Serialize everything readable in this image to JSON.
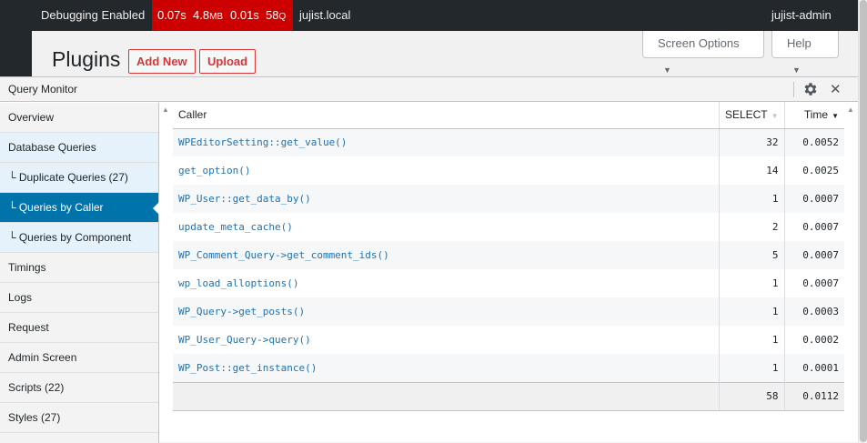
{
  "admin_bar": {
    "debugging": "Debugging Enabled",
    "qm_time": "0.07s",
    "qm_memory": "4.8",
    "qm_memory_unit": "MB",
    "qm_db_time": "0.01s",
    "qm_queries": "58",
    "qm_queries_unit": "Q",
    "site": "jujist.local",
    "user": "jujist-admin"
  },
  "page": {
    "title": "Plugins",
    "add_new": "Add New",
    "upload": "Upload",
    "screen_options": "Screen Options",
    "help": "Help"
  },
  "qm": {
    "title": "Query Monitor",
    "nav": [
      {
        "label": "Overview"
      },
      {
        "label": "Database Queries"
      },
      {
        "label": "└ Duplicate Queries (27)"
      },
      {
        "label": "└ Queries by Caller"
      },
      {
        "label": "└ Queries by Component"
      },
      {
        "label": "Timings"
      },
      {
        "label": "Logs"
      },
      {
        "label": "Request"
      },
      {
        "label": "Admin Screen"
      },
      {
        "label": "Scripts (22)"
      },
      {
        "label": "Styles (27)"
      }
    ],
    "table": {
      "headers": {
        "caller": "Caller",
        "select": "SELECT",
        "time": "Time"
      },
      "rows": [
        {
          "caller": "WPEditorSetting::get_value()",
          "select": "32",
          "time": "0.0052"
        },
        {
          "caller": "get_option()",
          "select": "14",
          "time": "0.0025"
        },
        {
          "caller": "WP_User::get_data_by()",
          "select": "1",
          "time": "0.0007"
        },
        {
          "caller": "update_meta_cache()",
          "select": "2",
          "time": "0.0007"
        },
        {
          "caller": "WP_Comment_Query->get_comment_ids()",
          "select": "5",
          "time": "0.0007"
        },
        {
          "caller": "wp_load_alloptions()",
          "select": "1",
          "time": "0.0007"
        },
        {
          "caller": "WP_Query->get_posts()",
          "select": "1",
          "time": "0.0003"
        },
        {
          "caller": "WP_User_Query->query()",
          "select": "1",
          "time": "0.0002"
        },
        {
          "caller": "WP_Post::get_instance()",
          "select": "1",
          "time": "0.0001"
        }
      ],
      "footer": {
        "select": "58",
        "time": "0.0112"
      }
    }
  },
  "colors": {
    "accent": "#0073aa",
    "danger": "#d63638",
    "qm_badge": "#cc0000",
    "admin_bar": "#23282d"
  }
}
